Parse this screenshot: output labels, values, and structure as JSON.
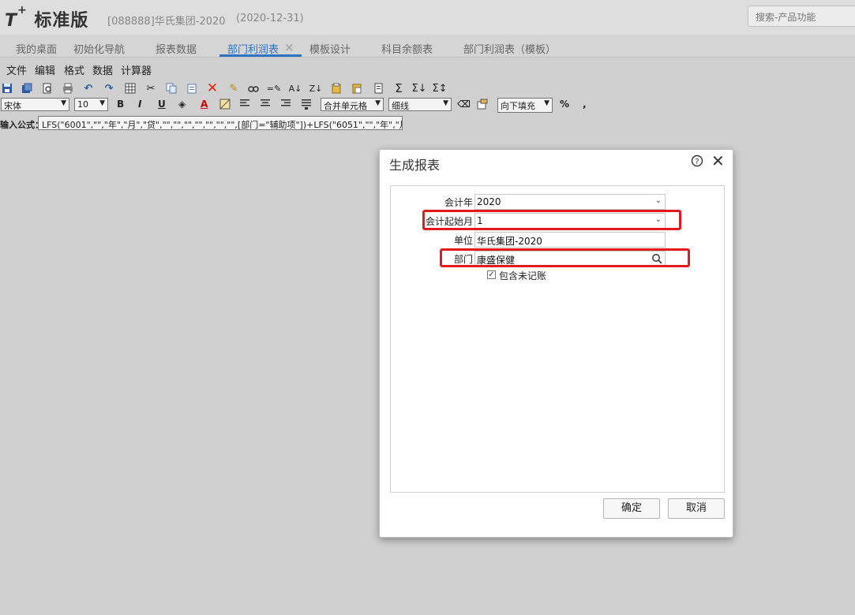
{
  "header": {
    "logo_mark": "T",
    "logo_plus": "+",
    "logo_name": "标准版",
    "company": "[088888]华氏集团-2020",
    "date": "(2020-12-31)",
    "search_placeholder": "搜索-产品功能"
  },
  "tabs": [
    {
      "label": "我的桌面"
    },
    {
      "label": "初始化导航"
    },
    {
      "label": "报表数据"
    },
    {
      "label": "部门利润表",
      "active": true
    },
    {
      "label": "模板设计"
    },
    {
      "label": "科目余额表"
    },
    {
      "label": "部门利润表（模板）"
    }
  ],
  "tab_close_glyph": "×",
  "menubar": [
    "文件",
    "编辑",
    "格式",
    "数据",
    "计算器"
  ],
  "toolbar2": {
    "font": "宋体",
    "size": "10",
    "bold": "B",
    "italic": "I",
    "underline": "U",
    "font_color": "A",
    "merge": "合并单元格",
    "border": "细线",
    "fill": "向下填充",
    "percent": "%",
    "comma": ","
  },
  "formula": {
    "label": "输入公式：",
    "value": "LFS(\"6001\",\"\",\"年\",\"月\",\"贷\",\"\",\"\",\"\",\"\",\"\",\"\",\"\",[部门=\"辅助项\"])+LFS(\"6051\",\"\",\"年\",\"月\",\"贷\",\"\",\"\",\"\","
  },
  "dialog": {
    "title": "生成报表",
    "fields": {
      "year_label": "会计年",
      "year_value": "2020",
      "start_month_label": "会计起始月",
      "start_month_value": "1",
      "unit_label": "单位",
      "unit_value": "华氏集团-2020",
      "dept_label": "部门",
      "dept_value": "康盛保健"
    },
    "checkbox_label": "包含未记账",
    "checkbox_checked": true,
    "ok_label": "确定",
    "cancel_label": "取消"
  },
  "colors": {
    "accent": "#2f73c4",
    "highlight_red": "#e3191e",
    "background": "#d0d0d0"
  }
}
